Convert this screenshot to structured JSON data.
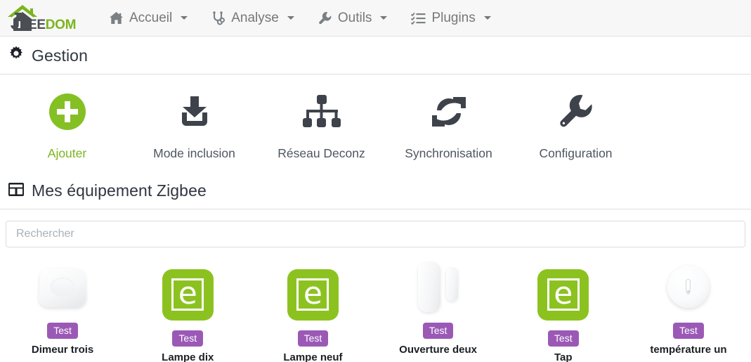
{
  "navbar": {
    "brand": {
      "ee": "EE",
      "dom": "DOM",
      "icon": "jeedom-house-logo"
    },
    "items": [
      {
        "label": "Accueil",
        "icon": "home-icon",
        "has_caret": true
      },
      {
        "label": "Analyse",
        "icon": "stethoscope-icon",
        "has_caret": true
      },
      {
        "label": "Outils",
        "icon": "wrench-icon",
        "has_caret": true
      },
      {
        "label": "Plugins",
        "icon": "list-check-icon",
        "has_caret": true
      }
    ]
  },
  "gestion_panel": {
    "icon": "gear-icon",
    "title": "Gestion",
    "actions": [
      {
        "label": "Ajouter",
        "icon": "plus-circle-icon",
        "accent": true
      },
      {
        "label": "Mode inclusion",
        "icon": "inbox-download-icon",
        "accent": false
      },
      {
        "label": "Réseau Deconz",
        "icon": "sitemap-icon",
        "accent": false
      },
      {
        "label": "Synchronisation",
        "icon": "refresh-sync-icon",
        "accent": false
      },
      {
        "label": "Configuration",
        "icon": "wrench-icon",
        "accent": false
      }
    ]
  },
  "equipment_panel": {
    "icon": "table-grid-icon",
    "title": "Mes équipement Zigbee",
    "search": {
      "placeholder": "Rechercher",
      "value": ""
    },
    "devices": [
      {
        "name": "Dimeur trois",
        "badge": "Test",
        "image": "white-square-button",
        "lower": false
      },
      {
        "name": "Lampe dix",
        "badge": "Test",
        "image": "green-e-tile",
        "lower": true
      },
      {
        "name": "Lampe neuf",
        "badge": "Test",
        "image": "green-e-tile",
        "lower": true
      },
      {
        "name": "Ouverture deux",
        "badge": "Test",
        "image": "door-contact-sensor",
        "lower": false
      },
      {
        "name": "Tap",
        "badge": "Test",
        "image": "green-e-tile",
        "lower": true
      },
      {
        "name": "température un",
        "badge": "Test",
        "image": "round-temp-sensor",
        "lower": false
      }
    ]
  },
  "colors": {
    "brand_green": "#7ab51d",
    "tile_green": "#8cc220",
    "badge_purple": "#9b59b6",
    "nav_text": "#777777",
    "navbar_bg": "#f7f7f7"
  }
}
